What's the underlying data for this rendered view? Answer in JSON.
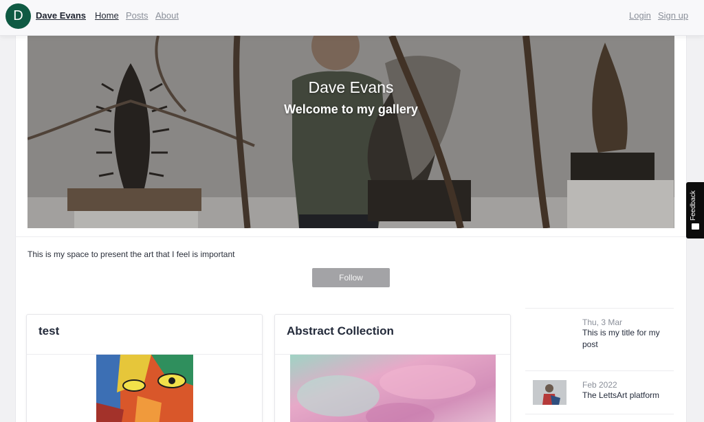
{
  "nav": {
    "avatar_letter": "D",
    "brand": "Dave Evans",
    "links": [
      "Home",
      "Posts",
      "About"
    ],
    "login": "Login",
    "signup": "Sign up"
  },
  "hero": {
    "title": "Dave Evans",
    "subtitle": "Welcome to my gallery"
  },
  "intro": "This is my space to present the art that I feel is important",
  "follow_label": "Follow",
  "posts": [
    {
      "title": "test"
    },
    {
      "title": "Abstract Collection"
    }
  ],
  "sidebar": [
    {
      "date": "Thu, 3 Mar",
      "title": "This is my title for my post"
    },
    {
      "date": "Feb 2022",
      "title": "The LettsArt platform"
    }
  ],
  "feedback_label": "Feedback",
  "colors": {
    "avatar": "#0f5a43",
    "follow_button": "#a3a3a6",
    "feedback_tab": "#0c0c0c"
  }
}
